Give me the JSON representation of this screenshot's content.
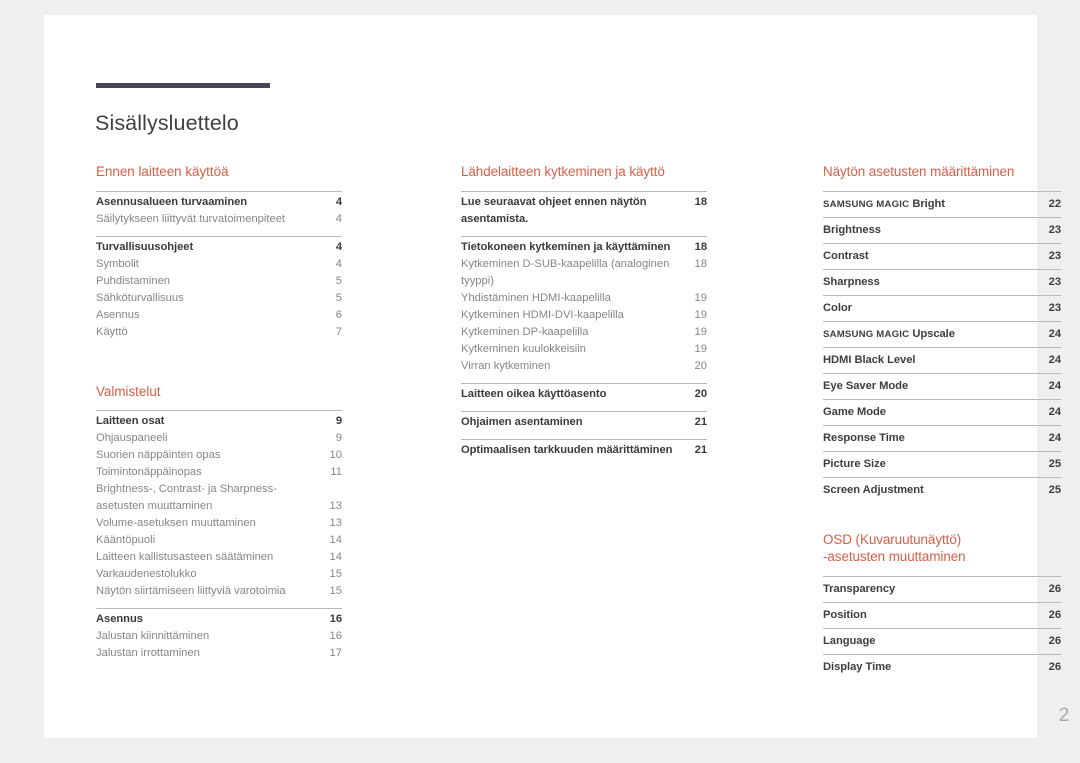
{
  "document": {
    "title": "Sisällysluettelo",
    "folio": "2",
    "accent_color": "#d65f48",
    "title_rule_color": "#474456",
    "page_background": "#ffffff",
    "canvas_background": "#efefef"
  },
  "columns": [
    {
      "name": "column-left",
      "sections": [
        {
          "heading": "Ennen laitteen käyttöä",
          "groups": [
            {
              "entries": [
                {
                  "label": "Asennusalueen turvaaminen",
                  "page": "4",
                  "level": "main"
                },
                {
                  "label": "Säilytykseen liittyvät turvatoimenpiteet",
                  "page": "4",
                  "level": "sub"
                }
              ]
            },
            {
              "entries": [
                {
                  "label": "Turvallisuusohjeet",
                  "page": "4",
                  "level": "main"
                },
                {
                  "label": "Symbolit",
                  "page": "4",
                  "level": "sub"
                },
                {
                  "label": "Puhdistaminen",
                  "page": "5",
                  "level": "sub"
                },
                {
                  "label": "Sähköturvallisuus",
                  "page": "5",
                  "level": "sub"
                },
                {
                  "label": "Asennus",
                  "page": "6",
                  "level": "sub"
                },
                {
                  "label": "Käyttö",
                  "page": "7",
                  "level": "sub"
                }
              ]
            }
          ]
        },
        {
          "heading": "Valmistelut",
          "groups": [
            {
              "entries": [
                {
                  "label": "Laitteen osat",
                  "page": "9",
                  "level": "main"
                },
                {
                  "label": "Ohjauspaneeli",
                  "page": "9",
                  "level": "sub"
                },
                {
                  "label": "Suorien näppäinten opas",
                  "page": "10",
                  "level": "sub"
                },
                {
                  "label": "Toimintonäppäinopas",
                  "page": "11",
                  "level": "sub"
                },
                {
                  "label": "Brightness-, Contrast- ja Sharpness-asetusten muuttaminen",
                  "page": "13",
                  "level": "sub",
                  "wrap": true
                },
                {
                  "label": "Volume-asetuksen muuttaminen",
                  "page": "13",
                  "level": "sub"
                },
                {
                  "label": "Kääntöpuoli",
                  "page": "14",
                  "level": "sub"
                },
                {
                  "label": "Laitteen kallistusasteen säätäminen",
                  "page": "14",
                  "level": "sub"
                },
                {
                  "label": "Varkaudenestolukko",
                  "page": "15",
                  "level": "sub"
                },
                {
                  "label": "Näytön siirtämiseen liittyviä varotoimia",
                  "page": "15",
                  "level": "sub"
                }
              ]
            },
            {
              "entries": [
                {
                  "label": "Asennus",
                  "page": "16",
                  "level": "main"
                },
                {
                  "label": "Jalustan kiinnittäminen",
                  "page": "16",
                  "level": "sub"
                },
                {
                  "label": "Jalustan irrottaminen",
                  "page": "17",
                  "level": "sub"
                }
              ]
            }
          ]
        }
      ]
    },
    {
      "name": "column-middle",
      "sections": [
        {
          "heading": "Lähdelaitteen kytkeminen ja käyttö",
          "groups": [
            {
              "entries": [
                {
                  "label": "Lue seuraavat ohjeet ennen näytön asentamista.",
                  "page": "18",
                  "level": "main",
                  "abut": true
                }
              ]
            },
            {
              "entries": [
                {
                  "label": "Tietokoneen kytkeminen ja käyttäminen",
                  "page": "18",
                  "level": "main"
                },
                {
                  "label": "Kytkeminen D-SUB-kaapelilla (analoginen tyyppi)",
                  "page": "18",
                  "level": "sub"
                },
                {
                  "label": "Yhdistäminen HDMI-kaapelilla",
                  "page": "19",
                  "level": "sub"
                },
                {
                  "label": "Kytkeminen HDMI-DVI-kaapelilla",
                  "page": "19",
                  "level": "sub"
                },
                {
                  "label": "Kytkeminen DP-kaapelilla",
                  "page": "19",
                  "level": "sub"
                },
                {
                  "label": "Kytkeminen kuulokkeisiin",
                  "page": "19",
                  "level": "sub"
                },
                {
                  "label": "Virran kytkeminen",
                  "page": "20",
                  "level": "sub"
                }
              ]
            },
            {
              "entries": [
                {
                  "label": "Laitteen oikea käyttöasento",
                  "page": "20",
                  "level": "main"
                }
              ]
            },
            {
              "entries": [
                {
                  "label": "Ohjaimen asentaminen",
                  "page": "21",
                  "level": "main"
                }
              ]
            },
            {
              "entries": [
                {
                  "label": "Optimaalisen tarkkuuden määrittäminen",
                  "page": "21",
                  "level": "main"
                }
              ]
            }
          ]
        }
      ]
    },
    {
      "name": "column-right",
      "sections": [
        {
          "heading": "Näytön asetusten määrittäminen",
          "groups": [
            {
              "entries": [
                {
                  "label": "SAMSUNG MAGIC Bright",
                  "brand": "SAMSUNG MAGIC",
                  "rest": " Bright",
                  "page": "22",
                  "level": "main"
                }
              ]
            },
            {
              "entries": [
                {
                  "label": "Brightness",
                  "page": "23",
                  "level": "main"
                }
              ]
            },
            {
              "entries": [
                {
                  "label": "Contrast",
                  "page": "23",
                  "level": "main"
                }
              ]
            },
            {
              "entries": [
                {
                  "label": "Sharpness",
                  "page": "23",
                  "level": "main"
                }
              ]
            },
            {
              "entries": [
                {
                  "label": "Color",
                  "page": "23",
                  "level": "main"
                }
              ]
            },
            {
              "entries": [
                {
                  "label": "SAMSUNG MAGIC Upscale",
                  "brand": "SAMSUNG MAGIC",
                  "rest": " Upscale",
                  "page": "24",
                  "level": "main"
                }
              ]
            },
            {
              "entries": [
                {
                  "label": "HDMI Black Level",
                  "page": "24",
                  "level": "main"
                }
              ]
            },
            {
              "entries": [
                {
                  "label": "Eye Saver Mode",
                  "page": "24",
                  "level": "main"
                }
              ]
            },
            {
              "entries": [
                {
                  "label": "Game Mode",
                  "page": "24",
                  "level": "main"
                }
              ]
            },
            {
              "entries": [
                {
                  "label": "Response Time",
                  "page": "24",
                  "level": "main"
                }
              ]
            },
            {
              "entries": [
                {
                  "label": "Picture Size",
                  "page": "25",
                  "level": "main"
                }
              ]
            },
            {
              "entries": [
                {
                  "label": "Screen Adjustment",
                  "page": "25",
                  "level": "main"
                }
              ]
            }
          ]
        },
        {
          "heading": "OSD (Kuvaruutunäyttö)\n-asetusten muuttaminen",
          "groups": [
            {
              "entries": [
                {
                  "label": "Transparency",
                  "page": "26",
                  "level": "main"
                }
              ]
            },
            {
              "entries": [
                {
                  "label": "Position",
                  "page": "26",
                  "level": "main"
                }
              ]
            },
            {
              "entries": [
                {
                  "label": "Language",
                  "page": "26",
                  "level": "main"
                }
              ]
            },
            {
              "entries": [
                {
                  "label": "Display Time",
                  "page": "26",
                  "level": "main"
                }
              ]
            }
          ]
        }
      ]
    }
  ]
}
